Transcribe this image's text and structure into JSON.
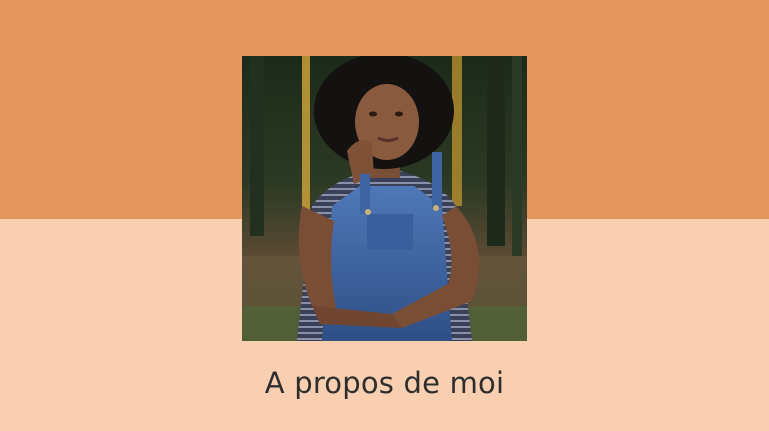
{
  "colors": {
    "top_band": "#E6975F",
    "bottom_band": "#F8D0B1",
    "title_text": "#2E2E2E"
  },
  "photo": {
    "icon": "portrait-photo"
  },
  "about": {
    "title": "A propos de moi"
  }
}
